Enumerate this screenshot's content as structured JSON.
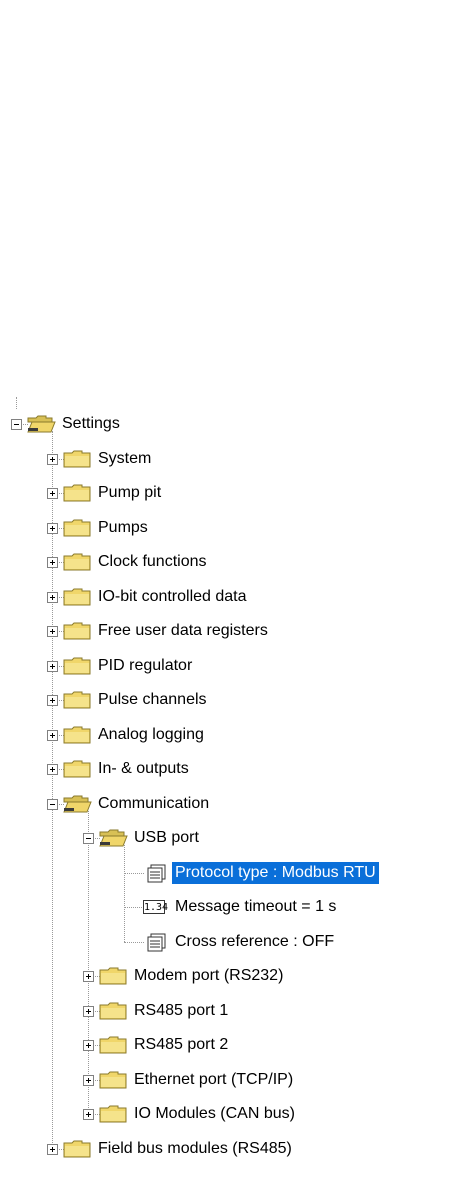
{
  "tree": {
    "nodes": [
      {
        "id": "settings",
        "label": "Settings",
        "level": 0,
        "state": "open",
        "icon": "folder-open-icon"
      },
      {
        "id": "system",
        "label": "System",
        "level": 1,
        "state": "closed",
        "icon": "folder-icon"
      },
      {
        "id": "pump-pit",
        "label": "Pump pit",
        "level": 1,
        "state": "closed",
        "icon": "folder-icon"
      },
      {
        "id": "pumps",
        "label": "Pumps",
        "level": 1,
        "state": "closed",
        "icon": "folder-icon"
      },
      {
        "id": "clock-functions",
        "label": "Clock functions",
        "level": 1,
        "state": "closed",
        "icon": "folder-icon"
      },
      {
        "id": "io-bit-controlled-data",
        "label": "IO-bit controlled data",
        "level": 1,
        "state": "closed",
        "icon": "folder-icon"
      },
      {
        "id": "free-user-data-registers",
        "label": "Free user data registers",
        "level": 1,
        "state": "closed",
        "icon": "folder-icon"
      },
      {
        "id": "pid-regulator",
        "label": "PID regulator",
        "level": 1,
        "state": "closed",
        "icon": "folder-icon"
      },
      {
        "id": "pulse-channels",
        "label": "Pulse channels",
        "level": 1,
        "state": "closed",
        "icon": "folder-icon"
      },
      {
        "id": "analog-logging",
        "label": "Analog logging",
        "level": 1,
        "state": "closed",
        "icon": "folder-icon"
      },
      {
        "id": "in-outputs",
        "label": "In- & outputs",
        "level": 1,
        "state": "closed",
        "icon": "folder-icon"
      },
      {
        "id": "communication",
        "label": "Communication",
        "level": 1,
        "state": "open",
        "icon": "folder-open-icon"
      },
      {
        "id": "usb-port",
        "label": "USB port",
        "level": 2,
        "state": "open",
        "icon": "folder-open-icon"
      },
      {
        "id": "protocol-type",
        "label": "Protocol type : Modbus RTU",
        "level": 3,
        "state": "leaf",
        "icon": "list-item-icon",
        "selected": true
      },
      {
        "id": "message-timeout",
        "label": "Message timeout = 1 s",
        "level": 3,
        "state": "leaf",
        "icon": "numeric-value-icon",
        "icon_text": "1.34"
      },
      {
        "id": "cross-reference",
        "label": "Cross reference : OFF",
        "level": 3,
        "state": "leaf",
        "icon": "list-item-icon"
      },
      {
        "id": "modem-port",
        "label": "Modem port (RS232)",
        "level": 2,
        "state": "closed",
        "icon": "folder-icon"
      },
      {
        "id": "rs485-port-1",
        "label": "RS485 port 1",
        "level": 2,
        "state": "closed",
        "icon": "folder-icon"
      },
      {
        "id": "rs485-port-2",
        "label": "RS485 port 2",
        "level": 2,
        "state": "closed",
        "icon": "folder-icon"
      },
      {
        "id": "ethernet-port",
        "label": "Ethernet port (TCP/IP)",
        "level": 2,
        "state": "closed",
        "icon": "folder-icon"
      },
      {
        "id": "io-modules",
        "label": "IO Modules (CAN bus)",
        "level": 2,
        "state": "closed",
        "icon": "folder-icon"
      },
      {
        "id": "field-bus-modules",
        "label": "Field bus modules (RS485)",
        "level": 1,
        "state": "closed",
        "icon": "folder-icon"
      }
    ]
  },
  "colors": {
    "selection": "#0a6fd9",
    "folder_fill": "#f0d66a",
    "folder_stroke": "#8a7a2c",
    "tree_lines": "#9a9a9a"
  }
}
